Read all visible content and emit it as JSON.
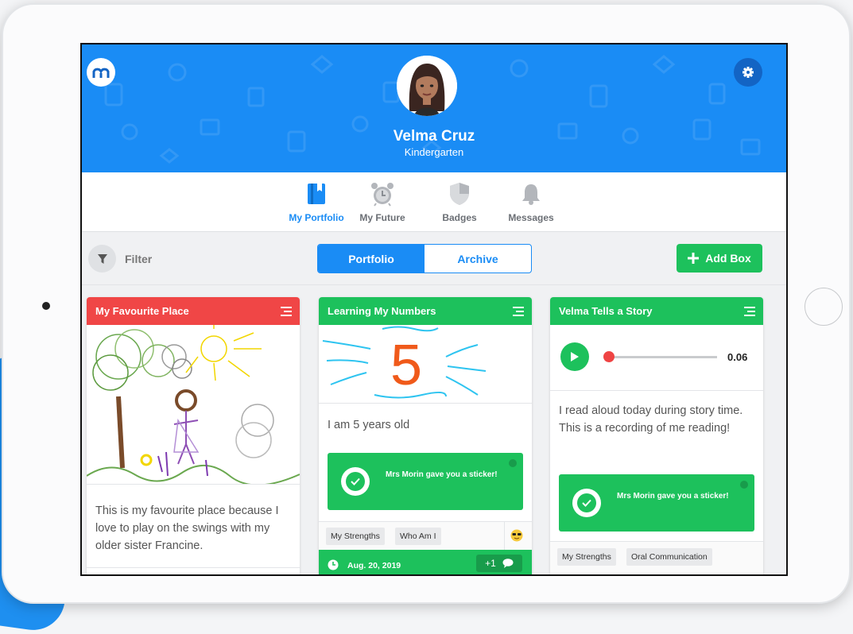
{
  "student": {
    "name": "Velma Cruz",
    "grade": "Kindergarten"
  },
  "header": {
    "logo_letter": "m",
    "logo_icon": "brand-logo-icon",
    "settings_icon": "gear-icon",
    "accent_color": "#1a8cf5"
  },
  "nav": {
    "tabs": [
      {
        "label": "My Portfolio",
        "icon": "portfolio-book-icon",
        "active": true
      },
      {
        "label": "My Future",
        "icon": "alarm-clock-icon",
        "active": false
      },
      {
        "label": "Badges",
        "icon": "shield-icon",
        "active": false
      },
      {
        "label": "Messages",
        "icon": "bell-icon",
        "active": false
      }
    ]
  },
  "toolbar": {
    "filter_label": "Filter",
    "segments": [
      "Portfolio",
      "Archive"
    ],
    "selected_segment": "Portfolio",
    "add_box_label": "Add Box"
  },
  "cards": [
    {
      "title": "My Favourite Place",
      "header_color": "#f04646",
      "text": "This is my favourite place because I love to play on the swings with my older sister Francine."
    },
    {
      "title": "Learning My Numbers",
      "header_color": "#1dc15c",
      "drawing_number": "5",
      "text": "I am 5 years old",
      "sticker": {
        "teacher": "Mrs Morin",
        "message": "gave you a sticker!"
      },
      "tags": [
        "My Strengths",
        "Who Am I"
      ],
      "reaction_icon": "sunglasses-emoji-icon",
      "date": "Aug. 20, 2019",
      "comment_count": "+1"
    },
    {
      "title": "Velma Tells a Story",
      "header_color": "#1dc15c",
      "audio_time": "0.06",
      "audio_progress": 0.03,
      "text": "I read aloud today during story time. This is a recording of me reading!",
      "sticker": {
        "teacher": "Mrs Morin",
        "message": "gave you a sticker!"
      },
      "tags": [
        "My Strengths",
        "Oral Communication"
      ]
    }
  ]
}
